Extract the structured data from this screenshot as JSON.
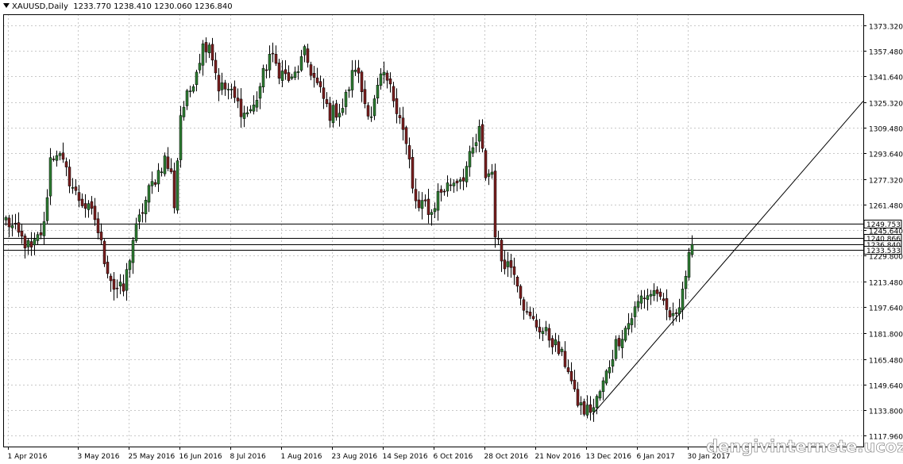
{
  "header": {
    "symbol": "XAUUSD,Daily",
    "ohlc": "1233.770 1238.410 1230.060 1236.840"
  },
  "watermark": "dengivinternete.ucoz.net",
  "colors": {
    "bull": "#2e7d32",
    "bear": "#7a1f1f",
    "grid": "#c8c8c8",
    "line": "#000000"
  },
  "chart_data": {
    "type": "candlestick",
    "y_ticks": [
      "1373.320",
      "1357.480",
      "1341.640",
      "1325.320",
      "1309.480",
      "1293.640",
      "1277.320",
      "1261.480",
      "1245.640",
      "1229.800",
      "1213.480",
      "1197.640",
      "1181.800",
      "1165.480",
      "1149.640",
      "1133.800",
      "1117.960"
    ],
    "y_tick_values": [
      1373.32,
      1357.48,
      1341.64,
      1325.32,
      1309.48,
      1293.64,
      1277.32,
      1261.48,
      1245.64,
      1229.8,
      1213.48,
      1197.64,
      1181.8,
      1165.48,
      1149.64,
      1133.8,
      1117.96
    ],
    "ylim": [
      1111,
      1380
    ],
    "x_labels": [
      "1 Apr 2016",
      "3 May 2016",
      "25 May 2016",
      "16 Jun 2016",
      "8 Jul 2016",
      "1 Aug 2016",
      "23 Aug 2016",
      "14 Sep 2016",
      "6 Oct 2016",
      "28 Oct 2016",
      "21 Nov 2016",
      "13 Dec 2016",
      "6 Jan 2017",
      "30 Jan 2017"
    ],
    "x_label_bars": [
      0,
      22,
      38,
      54,
      70,
      86,
      102,
      118,
      134,
      150,
      166,
      182,
      198,
      214
    ],
    "bars_total_slots": 277,
    "h_lines": [
      {
        "label": "1249.753",
        "value": 1249.753
      },
      {
        "label": "1240.866",
        "value": 1240.866
      },
      {
        "label": "1236.840",
        "value": 1236.84
      },
      {
        "label": "1233.533",
        "value": 1233.533
      }
    ],
    "trend_line": {
      "from": {
        "bar": 185,
        "price": 1131
      },
      "to": {
        "bar": 277,
        "price": 1326
      }
    },
    "waypoints": [
      [
        0,
        1252
      ],
      [
        8,
        1233
      ],
      [
        12,
        1248
      ],
      [
        14,
        1290
      ],
      [
        16,
        1295
      ],
      [
        22,
        1268
      ],
      [
        28,
        1253
      ],
      [
        31,
        1228
      ],
      [
        34,
        1210
      ],
      [
        37,
        1208
      ],
      [
        40,
        1240
      ],
      [
        45,
        1270
      ],
      [
        50,
        1290
      ],
      [
        52,
        1280
      ],
      [
        53,
        1262
      ],
      [
        55,
        1318
      ],
      [
        58,
        1333
      ],
      [
        62,
        1360
      ],
      [
        64,
        1363
      ],
      [
        67,
        1335
      ],
      [
        70,
        1333
      ],
      [
        75,
        1318
      ],
      [
        78,
        1322
      ],
      [
        83,
        1355
      ],
      [
        86,
        1345
      ],
      [
        90,
        1338
      ],
      [
        94,
        1355
      ],
      [
        97,
        1340
      ],
      [
        102,
        1318
      ],
      [
        106,
        1322
      ],
      [
        110,
        1348
      ],
      [
        113,
        1325
      ],
      [
        115,
        1318
      ],
      [
        118,
        1340
      ],
      [
        120,
        1338
      ],
      [
        124,
        1318
      ],
      [
        127,
        1288
      ],
      [
        128,
        1270
      ],
      [
        130,
        1258
      ],
      [
        132,
        1262
      ],
      [
        134,
        1256
      ],
      [
        136,
        1268
      ],
      [
        140,
        1275
      ],
      [
        144,
        1280
      ],
      [
        148,
        1300
      ],
      [
        149,
        1307
      ],
      [
        151,
        1280
      ],
      [
        153,
        1282
      ],
      [
        154,
        1245
      ],
      [
        156,
        1228
      ],
      [
        160,
        1222
      ],
      [
        164,
        1192
      ],
      [
        168,
        1185
      ],
      [
        172,
        1177
      ],
      [
        177,
        1160
      ],
      [
        179,
        1142
      ],
      [
        182,
        1133
      ],
      [
        185,
        1135
      ],
      [
        188,
        1150
      ],
      [
        192,
        1175
      ],
      [
        196,
        1188
      ],
      [
        200,
        1204
      ],
      [
        205,
        1208
      ],
      [
        206,
        1200
      ],
      [
        208,
        1195
      ],
      [
        210,
        1190
      ],
      [
        212,
        1202
      ],
      [
        214,
        1218
      ],
      [
        216,
        1236.84
      ]
    ]
  }
}
